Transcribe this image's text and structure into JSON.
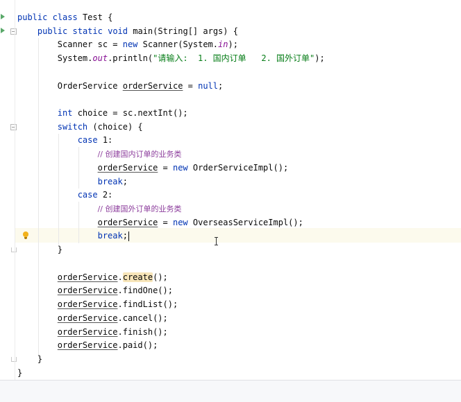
{
  "editor": {
    "lines": {
      "l1": {
        "kw1": "public",
        "kw2": "class",
        "name": "Test {"
      },
      "l2": {
        "kw1": "public",
        "kw2": "static",
        "kw3": "void",
        "rest": "main(String[] args) {"
      },
      "l3": {
        "pre": "Scanner sc = ",
        "kw": "new",
        "mid": "Scanner(System.",
        "field": "in",
        "post": ");"
      },
      "l4": {
        "pre": "System.",
        "field": "out",
        "mid": ".println(",
        "str": "\"请输入:  1. 国内订单   2. 国外订单\"",
        "post": ");"
      },
      "l6": {
        "pre": "OrderService ",
        "var": "orderService",
        "mid": " = ",
        "kw": "null",
        "post": ";"
      },
      "l8": {
        "kw": "int",
        "rest": " choice = sc.nextInt();"
      },
      "l9": {
        "kw": "switch",
        "rest": " (choice) {"
      },
      "l10": {
        "kw": "case",
        "rest": " 1:"
      },
      "l11": {
        "comment": "// 创建国内订单的业务类"
      },
      "l12": {
        "var": "orderService",
        "mid": " = ",
        "kw": "new",
        "post": " OrderServiceImpl();"
      },
      "l13": {
        "kw": "break",
        "post": ";"
      },
      "l14": {
        "kw": "case",
        "rest": " 2:"
      },
      "l15": {
        "comment": "// 创建国外订单的业务类"
      },
      "l16": {
        "var": "orderService",
        "mid": " = ",
        "kw": "new",
        "post": " OverseasServiceImpl();"
      },
      "l17": {
        "kw": "break",
        "post": ";"
      },
      "l18": {
        "text": "}"
      },
      "l20": {
        "var": "orderService",
        "dot": ".",
        "method": "create",
        "post": "();"
      },
      "l21": {
        "var": "orderService",
        "post": ".findOne();"
      },
      "l22": {
        "var": "orderService",
        "post": ".findList();"
      },
      "l23": {
        "var": "orderService",
        "post": ".cancel();"
      },
      "l24": {
        "var": "orderService",
        "post": ".finish();"
      },
      "l25": {
        "var": "orderService",
        "post": ".paid();"
      },
      "l26": {
        "text": "}"
      },
      "l27": {
        "text": "}"
      }
    }
  },
  "icons": {
    "run": "run-triangle-icon",
    "fold": "fold-marker-icon",
    "bulb": "lightbulb-icon",
    "cursor": "text-cursor-icon"
  },
  "colors": {
    "keyword": "#0033b3",
    "string": "#067d17",
    "field": "#871094",
    "comment": "#8c3d9c",
    "current_line": "#fcfaed",
    "highlight": "#f7e5b9"
  }
}
